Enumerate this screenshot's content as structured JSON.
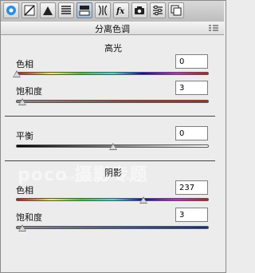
{
  "panel": {
    "title": "分离色调",
    "highlights": {
      "section_title": "高光",
      "hue_label": "色相",
      "hue_value": "0",
      "saturation_label": "饱和度",
      "saturation_value": "3"
    },
    "balance": {
      "label": "平衡",
      "value": "0"
    },
    "shadows": {
      "section_title": "阴影",
      "hue_label": "色相",
      "hue_value": "237",
      "saturation_label": "饱和度",
      "saturation_value": "3"
    }
  },
  "toolbar": {
    "icons": [
      "aperture-icon",
      "tone-curve-icon",
      "triangle-icon",
      "lines-icon",
      "hsl-icon",
      "split-toning-icon",
      "fx-icon",
      "camera-icon",
      "sliders-icon",
      "presets-icon"
    ]
  },
  "watermark": {
    "text": "poco 摄影专题",
    "url": "http://photo.poco.cn/"
  }
}
